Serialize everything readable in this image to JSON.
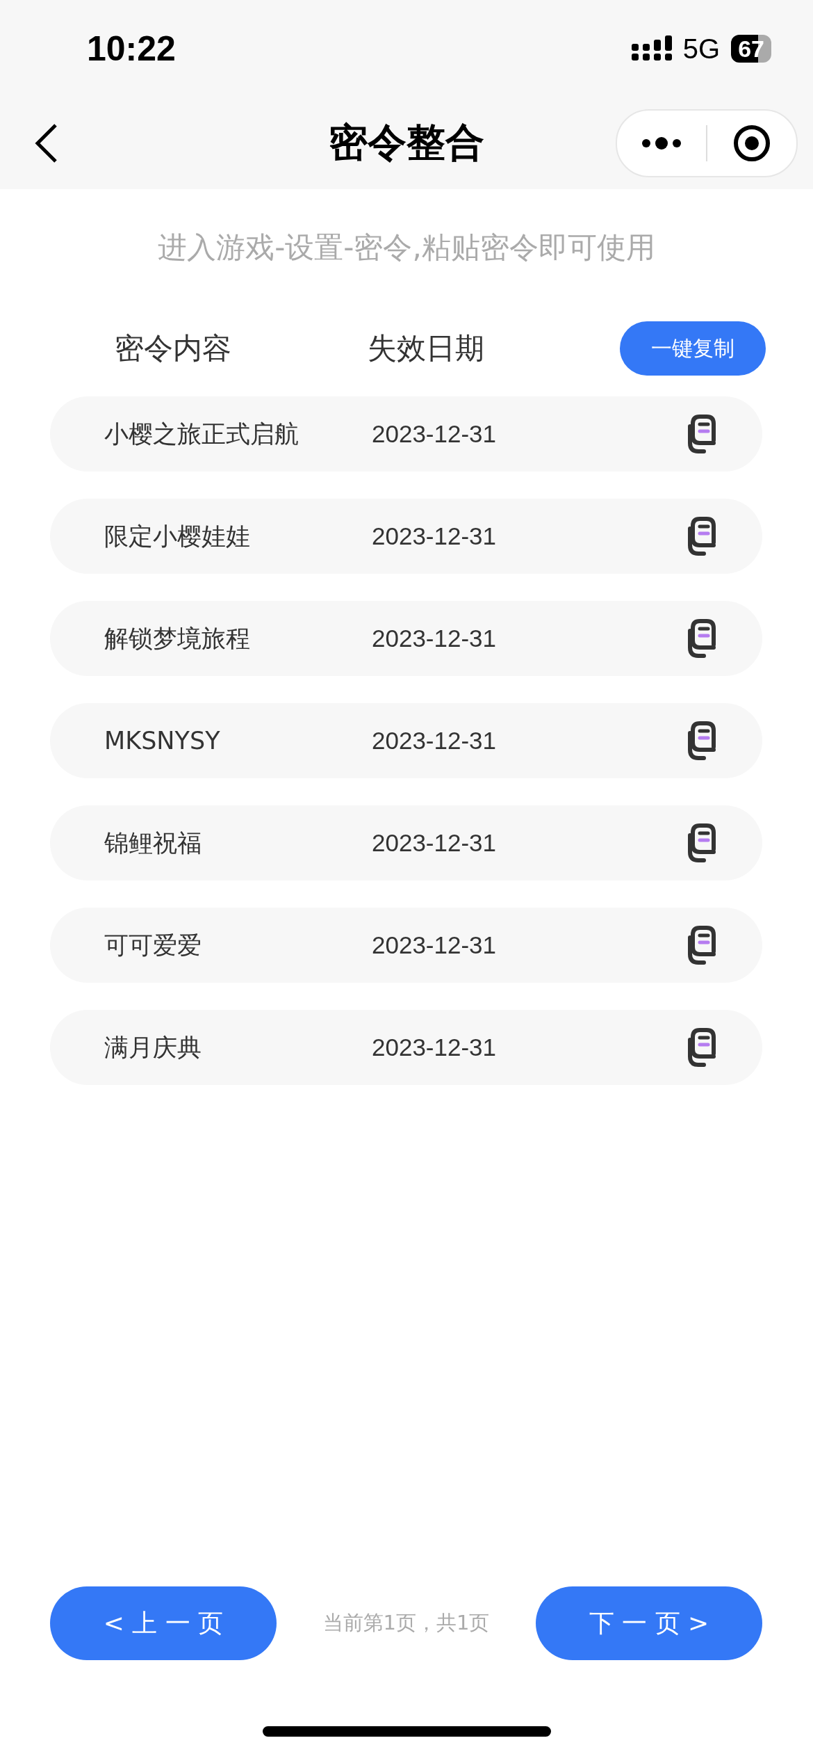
{
  "status_bar": {
    "time": "10:22",
    "network": "5G",
    "battery": "67"
  },
  "nav": {
    "title": "密令整合"
  },
  "hint": "进入游戏-设置-密令,粘贴密令即可使用",
  "table": {
    "columns": [
      "密令内容",
      "失效日期"
    ],
    "copy_all": "一键复制",
    "rows": [
      {
        "code": "小樱之旅正式启航",
        "expires": "2023-12-31"
      },
      {
        "code": "限定小樱娃娃",
        "expires": "2023-12-31"
      },
      {
        "code": "解锁梦境旅程",
        "expires": "2023-12-31"
      },
      {
        "code": "MKSNYSY",
        "expires": "2023-12-31"
      },
      {
        "code": "锦鲤祝福",
        "expires": "2023-12-31"
      },
      {
        "code": "可可爱爱",
        "expires": "2023-12-31"
      },
      {
        "code": "满月庆典",
        "expires": "2023-12-31"
      }
    ]
  },
  "pager": {
    "prev": "< 上 一 页",
    "info": "当前第1页，共1页",
    "next": "下 一 页 >"
  }
}
